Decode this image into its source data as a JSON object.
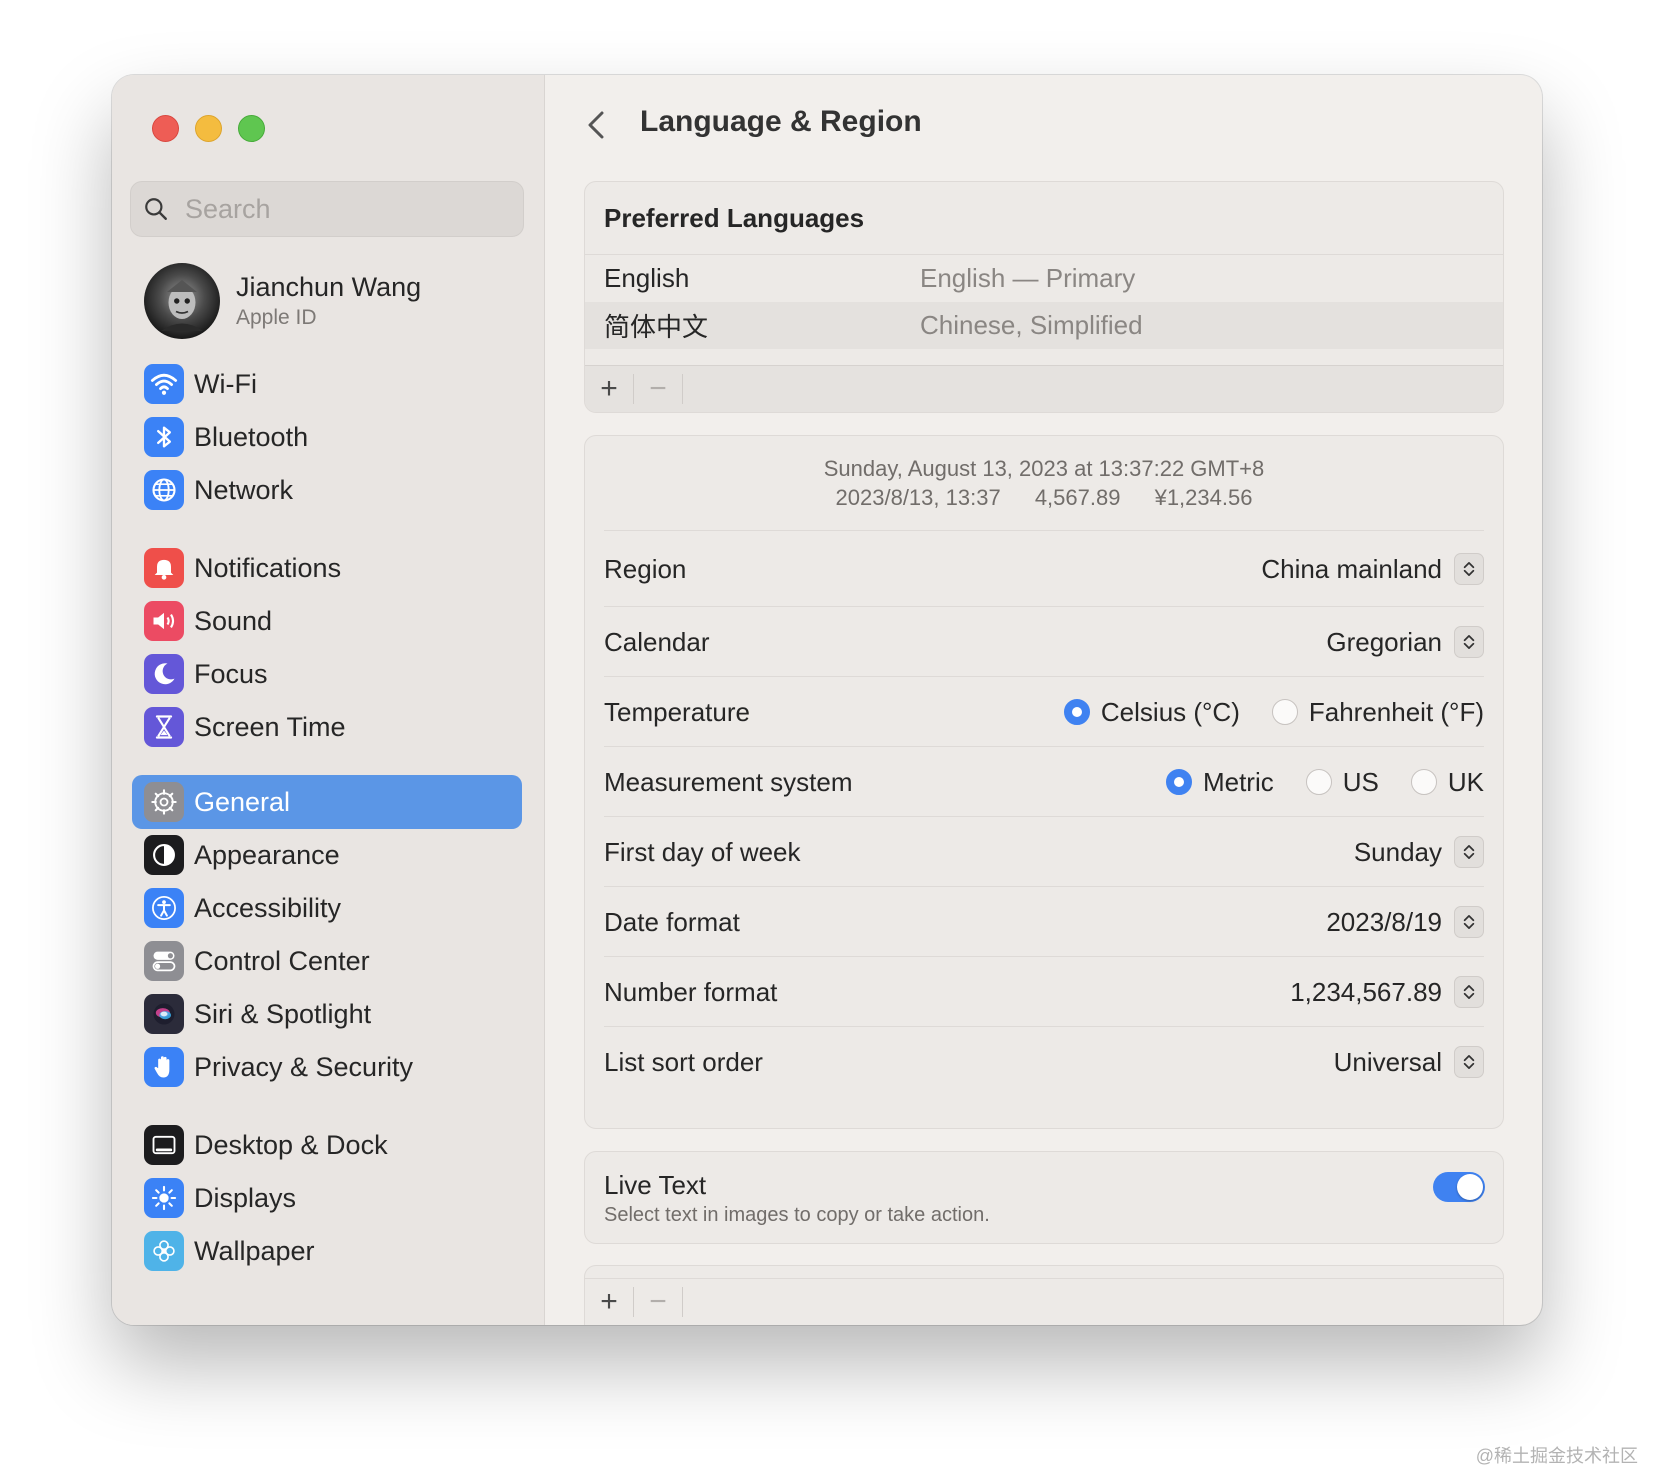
{
  "window": {
    "sidebar": {
      "search_placeholder": "Search",
      "profile": {
        "name": "Jianchun Wang",
        "subtitle": "Apple ID"
      },
      "items": [
        {
          "label": "Wi-Fi",
          "icon": "wifi-icon",
          "color": "#3b82f6"
        },
        {
          "label": "Bluetooth",
          "icon": "bluetooth-icon",
          "color": "#3b82f6"
        },
        {
          "label": "Network",
          "icon": "globe-icon",
          "color": "#3b82f6"
        },
        {
          "label": "Notifications",
          "icon": "bell-icon",
          "color": "#ef4444"
        },
        {
          "label": "Sound",
          "icon": "speaker-icon",
          "color": "#ec4b63"
        },
        {
          "label": "Focus",
          "icon": "moon-icon",
          "color": "#6457d8"
        },
        {
          "label": "Screen Time",
          "icon": "hourglass-icon",
          "color": "#6457d8"
        },
        {
          "label": "General",
          "icon": "gear-icon",
          "color": "#8e8e93",
          "selected": true
        },
        {
          "label": "Appearance",
          "icon": "appearance-icon",
          "color": "#1c1c1e"
        },
        {
          "label": "Accessibility",
          "icon": "accessibility-icon",
          "color": "#3b82f6"
        },
        {
          "label": "Control Center",
          "icon": "toggles-icon",
          "color": "#8e8e93"
        },
        {
          "label": "Siri & Spotlight",
          "icon": "siri-icon",
          "color": "#2b2b3a"
        },
        {
          "label": "Privacy & Security",
          "icon": "hand-icon",
          "color": "#3b82f6"
        },
        {
          "label": "Desktop & Dock",
          "icon": "dock-icon",
          "color": "#1c1c1e"
        },
        {
          "label": "Displays",
          "icon": "sun-icon",
          "color": "#3b82f6"
        },
        {
          "label": "Wallpaper",
          "icon": "flower-icon",
          "color": "#4fb3e8"
        }
      ]
    },
    "main": {
      "title": "Language & Region",
      "preferred_languages": {
        "heading": "Preferred Languages",
        "rows": [
          {
            "name": "English",
            "description": "English — Primary"
          },
          {
            "name": "简体中文",
            "description": "Chinese, Simplified"
          }
        ],
        "add_label": "+",
        "remove_label": "−"
      },
      "preview": {
        "line1": "Sunday, August 13, 2023 at 13:37:22 GMT+8",
        "date": "2023/8/13, 13:37",
        "number": "4,567.89",
        "currency": "¥1,234.56"
      },
      "settings": {
        "region": {
          "label": "Region",
          "value": "China mainland"
        },
        "calendar": {
          "label": "Calendar",
          "value": "Gregorian"
        },
        "temperature": {
          "label": "Temperature",
          "options": [
            "Celsius (°C)",
            "Fahrenheit (°F)"
          ],
          "selected": "Celsius (°C)"
        },
        "measurement": {
          "label": "Measurement system",
          "options": [
            "Metric",
            "US",
            "UK"
          ],
          "selected": "Metric"
        },
        "first_day": {
          "label": "First day of week",
          "value": "Sunday"
        },
        "date_format": {
          "label": "Date format",
          "value": "2023/8/19"
        },
        "number_format": {
          "label": "Number format",
          "value": "1,234,567.89"
        },
        "sort_order": {
          "label": "List sort order",
          "value": "Universal"
        }
      },
      "live_text": {
        "title": "Live Text",
        "subtitle": "Select text in images to copy or take action.",
        "enabled": true
      },
      "bottom_list": {
        "add_label": "+",
        "remove_label": "−"
      }
    }
  },
  "watermark": "@稀土掘金技术社区",
  "colors": {
    "accent": "#3f82f1",
    "selection": "#5b96e6"
  }
}
